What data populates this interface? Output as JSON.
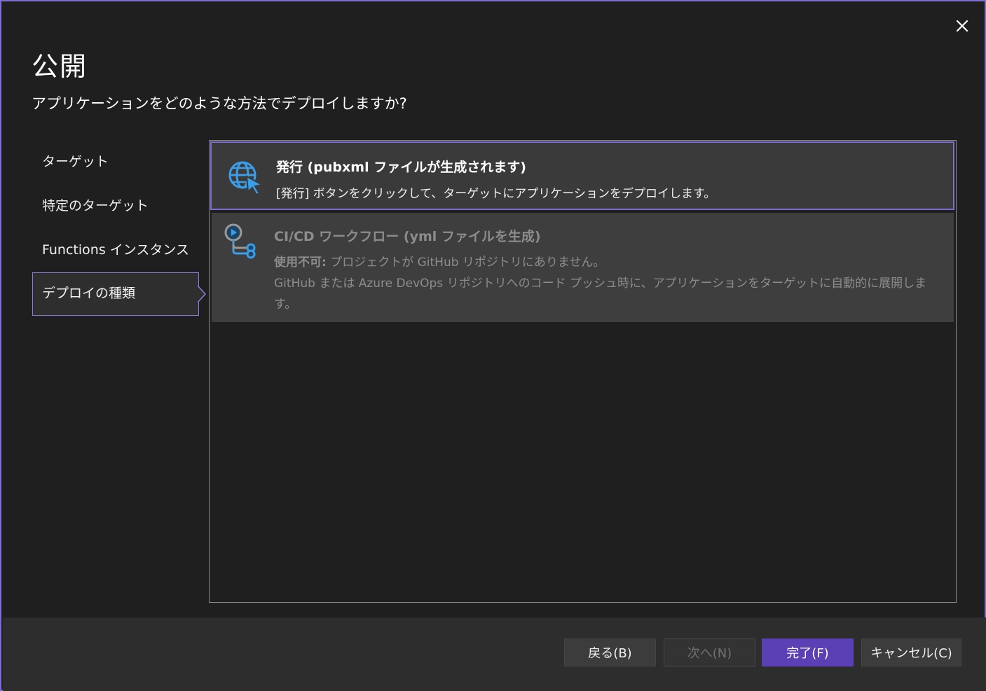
{
  "dialog": {
    "title": "公開",
    "subtitle": "アプリケーションをどのような方法でデプロイしますか?",
    "close_icon": "close-icon"
  },
  "nav": {
    "items": [
      {
        "label": "ターゲット"
      },
      {
        "label": "特定のターゲット"
      },
      {
        "label": "Functions インスタンス"
      },
      {
        "label": "デプロイの種類",
        "active": true
      }
    ]
  },
  "options": [
    {
      "icon": "globe-publish-icon",
      "title": "発行 (pubxml ファイルが生成されます)",
      "description": "[発行] ボタンをクリックして、ターゲットにアプリケーションをデプロイします。",
      "selected": true
    },
    {
      "icon": "ci-cd-workflow-icon",
      "title": "CI/CD ワークフロー (yml ファイルを生成)",
      "unavailable_label": "使用不可:",
      "unavailable_reason": " プロジェクトが GitHub リポジトリにありません。",
      "description": "GitHub または Azure DevOps リポジトリへのコード プッシュ時に、アプリケーションをターゲットに自動的に展開します。",
      "disabled": true
    }
  ],
  "footer": {
    "back_label": "戻る(B)",
    "next_label": "次へ(N)",
    "finish_label": "完了(F)",
    "cancel_label": "キャンセル(C)"
  },
  "colors": {
    "accent": "#7c6fd1",
    "primary_button": "#5b3fb5",
    "icon_blue": "#3b9ee8"
  }
}
